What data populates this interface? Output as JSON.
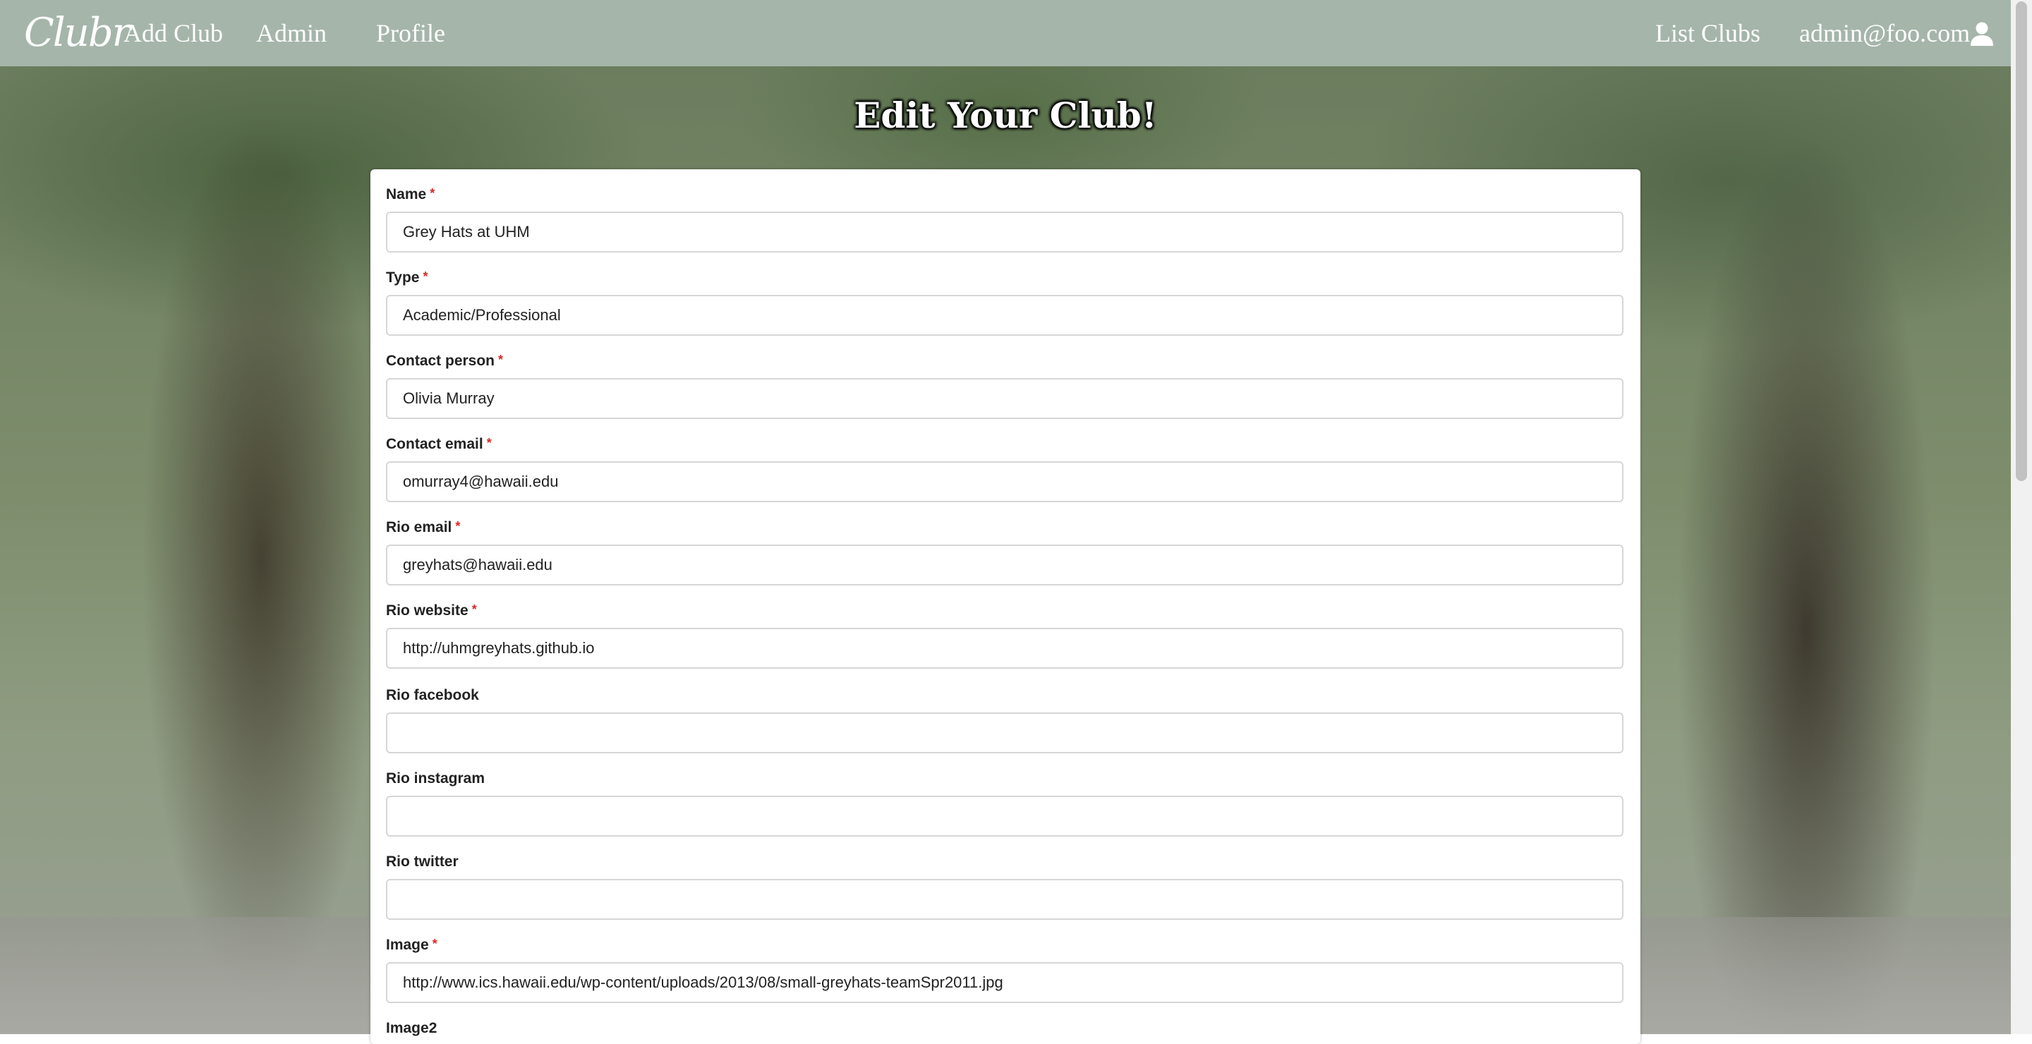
{
  "navbar": {
    "brand": "Clubr",
    "links": [
      "Add Club",
      "Admin",
      "Profile"
    ],
    "list_clubs": "List Clubs",
    "user": "admin@foo.com",
    "user_icon": "user-icon"
  },
  "page": {
    "title": "Edit Your Club!"
  },
  "form": {
    "fields": [
      {
        "label": "Name",
        "required": "*",
        "value": "Grey Hats at UHM"
      },
      {
        "label": "Type",
        "required": "*",
        "value": "Academic/Professional"
      },
      {
        "label": "Contact person",
        "required": "*",
        "value": "Olivia Murray"
      },
      {
        "label": "Contact email",
        "required": "*",
        "value": "omurray4@hawaii.edu"
      },
      {
        "label": "Rio email",
        "required": "*",
        "value": "greyhats@hawaii.edu"
      },
      {
        "label": "Rio website",
        "required": "*",
        "value": "http://uhmgreyhats.github.io"
      },
      {
        "label": "Rio facebook",
        "required": "",
        "value": ""
      },
      {
        "label": "Rio instagram",
        "required": "",
        "value": ""
      },
      {
        "label": "Rio twitter",
        "required": "",
        "value": ""
      },
      {
        "label": "Image",
        "required": "*",
        "value": "http://www.ics.hawaii.edu/wp-content/uploads/2013/08/small-greyhats-teamSpr2011.jpg"
      },
      {
        "label": "Image2",
        "required": "",
        "value": ""
      }
    ]
  },
  "colors": {
    "navbar": "#a5b5aa",
    "required_marker": "#db2828"
  }
}
